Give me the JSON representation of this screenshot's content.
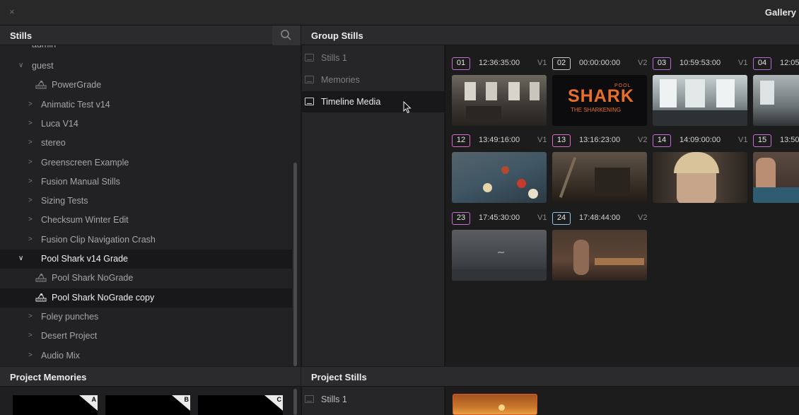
{
  "window": {
    "close_glyph": "×",
    "title": "Gallery"
  },
  "stills_panel": {
    "header": "Stills",
    "search_icon": "search-icon",
    "partial_top_label": "admin",
    "tree": [
      {
        "label": "guest",
        "level": 0,
        "expanded": true,
        "kind": "folder"
      },
      {
        "label": "PowerGrade",
        "level": 1,
        "kind": "powergrade"
      },
      {
        "label": "Animatic Test v14",
        "level": 0,
        "kind": "folder"
      },
      {
        "label": "Luca V14",
        "level": 0,
        "kind": "folder"
      },
      {
        "label": "stereo",
        "level": 0,
        "kind": "folder"
      },
      {
        "label": "Greenscreen Example",
        "level": 0,
        "kind": "folder"
      },
      {
        "label": "Fusion Manual Stills",
        "level": 0,
        "kind": "folder"
      },
      {
        "label": "Sizing Tests",
        "level": 0,
        "kind": "folder"
      },
      {
        "label": "Checksum Winter Edit",
        "level": 0,
        "kind": "folder"
      },
      {
        "label": "Fusion Clip Navigation Crash",
        "level": 0,
        "kind": "folder"
      },
      {
        "label": "Pool Shark v14 Grade",
        "level": 0,
        "expanded": true,
        "kind": "folder",
        "selected": true
      },
      {
        "label": "Pool Shark NoGrade",
        "level": 1,
        "kind": "powergrade"
      },
      {
        "label": "Pool Shark NoGrade copy",
        "level": 1,
        "kind": "powergrade",
        "selected": true
      },
      {
        "label": "Foley punches",
        "level": 0,
        "kind": "folder"
      },
      {
        "label": "Desert Project",
        "level": 0,
        "kind": "folder"
      },
      {
        "label": "Audio Mix",
        "level": 0,
        "kind": "folder"
      }
    ]
  },
  "group_stills": {
    "header": "Group Stills",
    "albums": [
      {
        "label": "Stills 1",
        "selected": false
      },
      {
        "label": "Memories",
        "selected": false
      },
      {
        "label": "Timeline Media",
        "selected": true
      }
    ],
    "stills": [
      {
        "num": "01",
        "tc": "12:36:35:00",
        "track": "V1",
        "color": "#c86cd8",
        "thumb": "loft"
      },
      {
        "num": "02",
        "tc": "00:00:00:00",
        "track": "V2",
        "color": "#c8c8c8",
        "thumb": "title"
      },
      {
        "num": "03",
        "tc": "10:59:53:00",
        "track": "V1",
        "color": "#b26cd8",
        "thumb": "office"
      },
      {
        "num": "04",
        "tc": "12:05",
        "track": "",
        "color": "#b26cd8",
        "thumb": "office2"
      },
      {
        "num": "12",
        "tc": "13:49:16:00",
        "track": "V1",
        "color": "#d86cc4",
        "thumb": "pool"
      },
      {
        "num": "13",
        "tc": "13:16:23:00",
        "track": "V2",
        "color": "#d86cc4",
        "thumb": "room"
      },
      {
        "num": "14",
        "tc": "14:09:00:00",
        "track": "V1",
        "color": "#c86cd8",
        "thumb": "face"
      },
      {
        "num": "15",
        "tc": "13:50",
        "track": "",
        "color": "#c86cd8",
        "thumb": "player"
      },
      {
        "num": "23",
        "tc": "17:45:30:00",
        "track": "V1",
        "color": "#c86cd8",
        "thumb": "graffiti"
      },
      {
        "num": "24",
        "tc": "17:48:44:00",
        "track": "V2",
        "color": "#8bc8e8",
        "thumb": "bar"
      }
    ],
    "title_card": {
      "small": "POOL",
      "big": "SHARK",
      "sub": "THE SHARKENING"
    }
  },
  "project_memories": {
    "header": "Project Memories",
    "slots": [
      {
        "letter": "A"
      },
      {
        "letter": "B"
      },
      {
        "letter": "C"
      }
    ]
  },
  "project_stills": {
    "header": "Project Stills",
    "albums": [
      {
        "label": "Stills 1"
      }
    ]
  }
}
